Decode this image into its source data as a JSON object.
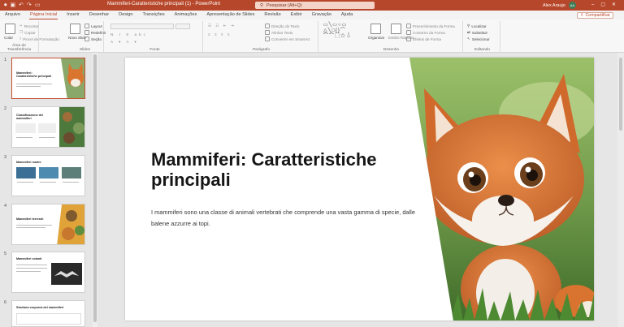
{
  "titlebar": {
    "window_title": "Mammiferi-Caratteristiche principali (1) - PowerPoint",
    "search_placeholder": "Pesquisar (Alt+Q)",
    "user_name": "Alex Araujo",
    "user_initials": "AA",
    "quick_access_icons": [
      "autosave-icon",
      "save-icon",
      "undo-icon",
      "redo-icon",
      "present-icon"
    ]
  },
  "tabs": [
    "Arquivo",
    "Página Inicial",
    "Inserir",
    "Desenhar",
    "Design",
    "Transições",
    "Animações",
    "Apresentação de Slides",
    "Revisão",
    "Exibir",
    "Gravação",
    "Ajuda"
  ],
  "active_tab": "Página Inicial",
  "share_label": "Compartilhar",
  "ribbon": {
    "clipboard": {
      "label": "Área de Transferência",
      "paste": "Colar",
      "cut": "Recortar",
      "copy": "Copiar",
      "format_painter": "Pincel de Formatação"
    },
    "slides": {
      "label": "Slides",
      "new_slide": "Novo Slide",
      "layout": "Layout",
      "reset": "Redefinir",
      "section": "Seção"
    },
    "font": {
      "label": "Fonte"
    },
    "paragraph": {
      "label": "Parágrafo",
      "text_direction": "Direção do Texto",
      "align_text": "Alinhar Texto",
      "smartart": "Converter em SmartArt"
    },
    "drawing": {
      "label": "Desenho",
      "arrange": "Organizar",
      "quick_styles": "Estilos Rápidos",
      "shape_fill": "Preenchimento da Forma",
      "shape_outline": "Contorno da Forma",
      "shape_effects": "Efeitos de Forma"
    },
    "editing": {
      "label": "Editando",
      "find": "Localizar",
      "replace": "Substituir",
      "select": "Selecionar"
    }
  },
  "thumbnails": [
    {
      "num": "1",
      "title": "Mammiferi: Caratteristiche principali"
    },
    {
      "num": "2",
      "title": "Classificazione dei mammiferi"
    },
    {
      "num": "3",
      "title": "Mammiferi marini"
    },
    {
      "num": "4",
      "title": "Mammiferi terrestri"
    },
    {
      "num": "5",
      "title": "Mammiferi volanti"
    },
    {
      "num": "6",
      "title": "Struttura corporea dei mammiferi"
    }
  ],
  "slide": {
    "title": "Mammiferi: Caratteristiche principali",
    "body": "I mammiferi sono una classe di animali vertebrati che comprende una vasta gamma di specie, dalle balene azzurre ai topi."
  },
  "colors": {
    "accent": "#b7472a",
    "selection": "#c4502f"
  }
}
